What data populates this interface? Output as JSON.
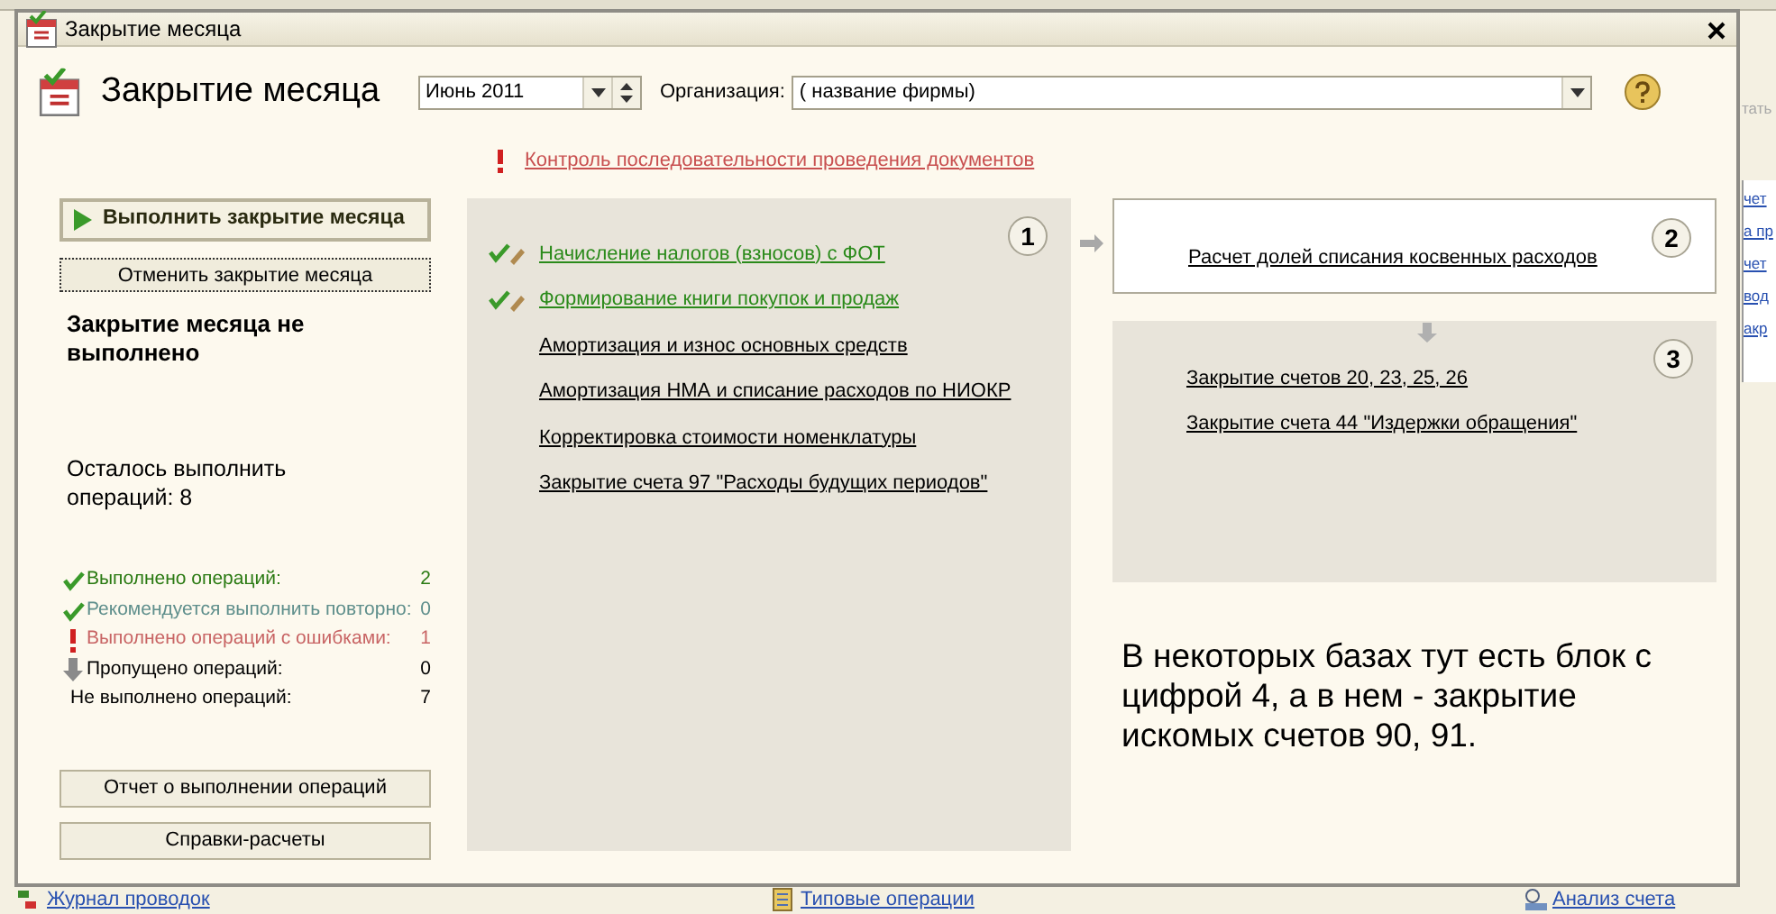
{
  "background": {
    "top_right_text": "тать",
    "right_links": [
      "чет",
      "а пр",
      "чет",
      "вод",
      "акр"
    ],
    "bottom_links": [
      {
        "label": "Журнал проводок",
        "kind": "journal"
      },
      {
        "label": "Типовые операции",
        "kind": "ops"
      },
      {
        "label": "Анализ счета",
        "kind": "analysis"
      }
    ]
  },
  "window": {
    "title": "Закрытие месяца"
  },
  "header": {
    "title": "Закрытие месяца",
    "period": "Июнь 2011",
    "org_label": "Организация:",
    "org_value": "( название фирмы)"
  },
  "warning_link": "Контроль последовательности проведения документов",
  "buttons": [
    {
      "label": "Выполнить закрытие месяца",
      "kind": "primary"
    },
    {
      "label": "Отменить закрытие месяца",
      "kind": "secondary"
    }
  ],
  "status": "Закрытие месяца не выполнено",
  "remaining": "Осталось выполнить операций: 8",
  "counters": [
    {
      "kind": "done",
      "label": "Выполнено операций:",
      "value": "2",
      "color": "#2a7a12"
    },
    {
      "kind": "repeat",
      "label": "Рекомендуется выполнить повторно:",
      "value": "0",
      "color": "#5f8f8c"
    },
    {
      "kind": "error",
      "label": "Выполнено операций с ошибками:",
      "value": "1",
      "color": "#c86464"
    },
    {
      "kind": "skipped",
      "label": "Пропущено операций:",
      "value": "0",
      "color": "#000000"
    },
    {
      "kind": "none",
      "label": "Не выполнено операций:",
      "value": "7",
      "color": "#000000"
    }
  ],
  "report_buttons": [
    "Отчет о выполнении операций",
    "Справки-расчеты"
  ],
  "stages": [
    {
      "number": "1",
      "kind": "grey",
      "operations": [
        {
          "label": "Начисление налогов (взносов) с ФОТ",
          "done": true
        },
        {
          "label": "Формирование книги покупок и продаж",
          "done": true
        },
        {
          "label": "Амортизация и износ основных средств",
          "done": false
        },
        {
          "label": "Амортизация НМА и списание расходов по НИОКР",
          "done": false
        },
        {
          "label": "Корректировка стоимости номенклатуры",
          "done": false
        },
        {
          "label": "Закрытие счета 97 \"Расходы будущих периодов\"",
          "done": false
        }
      ]
    },
    {
      "number": "2",
      "kind": "white",
      "operations": [
        {
          "label": "Расчет долей списания косвенных расходов",
          "done": false
        }
      ]
    },
    {
      "number": "3",
      "kind": "grey",
      "operations": [
        {
          "label": "Закрытие счетов 20, 23, 25, 26",
          "done": false
        },
        {
          "label": "Закрытие счета 44 \"Издержки обращения\"",
          "done": false
        }
      ]
    }
  ],
  "note": "В некоторых базах тут есть блок с цифрой 4, а в нем - закрытие искомых счетов 90, 91."
}
